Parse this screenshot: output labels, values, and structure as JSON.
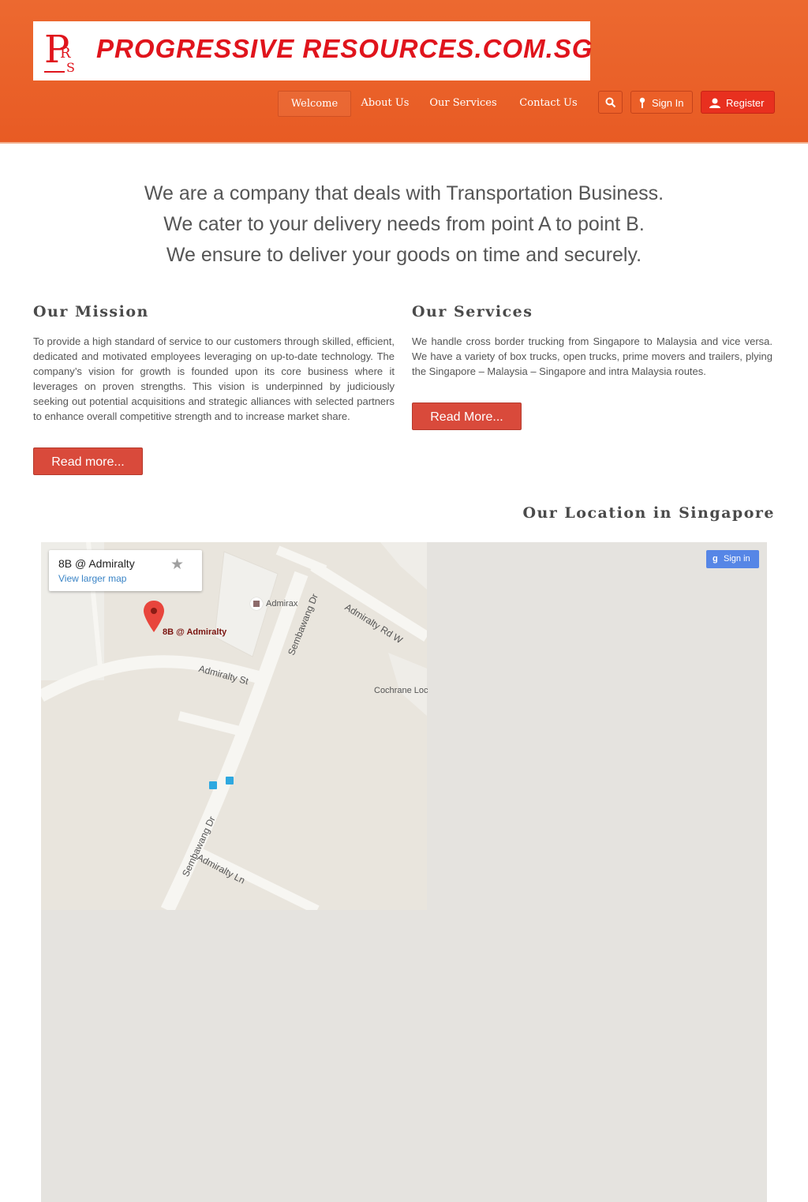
{
  "brand": {
    "logo_text": "PROGRESSIVE RESOURCES.COM.SG",
    "logo_mark": "PRS",
    "colors": {
      "header": "#e95f27",
      "accent": "#e0141c",
      "button": "#d94a3b"
    }
  },
  "nav": {
    "items": [
      "Welcome",
      "About Us",
      "Our Services",
      "Contact Us"
    ],
    "active": "Welcome",
    "search_icon": "search-icon",
    "sign_in": "Sign In",
    "register": "Register"
  },
  "intro": {
    "lines": [
      "We are a company that deals with Transportation Business.",
      "We cater to your delivery needs from point A to point B.",
      "We ensure to deliver your goods on time and securely."
    ]
  },
  "mission": {
    "title": "Our Mission",
    "text": "To provide a high standard of service to our customers through skilled, efficient, dedicated and motivated employees leveraging on up-to-date technology. The company’s vision for growth is founded upon its core business where it leverages on proven strengths. This vision is underpinned by judiciously seeking out potential acquisitions and strategic alliances with selected partners to enhance overall competitive strength and to increase market share.",
    "button": "Read more..."
  },
  "services": {
    "title": "Our Services",
    "text": "We handle cross border trucking from Singapore to Malaysia and vice versa. We have a variety of box trucks, open trucks, prime movers and trailers, plying the Singapore – Malaysia – Singapore and intra Malaysia routes.",
    "button": "Read More..."
  },
  "location": {
    "title": "Our Location in Singapore",
    "map": {
      "place_name": "8B @ Admiralty",
      "larger_map_link": "View larger map",
      "sign_in": "Sign in",
      "labels": {
        "marker": "8B @ Admiralty",
        "admirax": "Admirax",
        "admiralty_rd_w": "Admiralty Rd W",
        "sembawang_dr_top": "Sembawang Dr",
        "admiralty_st": "Admiralty St",
        "cochrane": "Cochrane Loc",
        "sembawang_dr_bottom": "Sembawang Dr",
        "admiralty_ln": "Admiralty Ln"
      }
    }
  }
}
